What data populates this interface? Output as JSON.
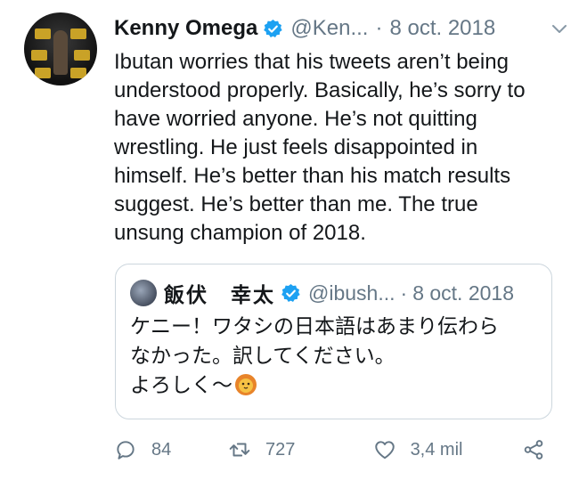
{
  "tweet": {
    "author_name": "Kenny Omega",
    "author_handle": "@Ken...",
    "separator": "·",
    "date": "8 oct. 2018",
    "text": "Ibutan worries that his tweets aren’t being\nunderstood properly. Basically, he’s sorry to\nhave worried anyone. He’s not quitting\nwrestling. He just feels disappointed in\nhimself. He’s better than his match results\nsuggest. He’s better than me. The true\nunsung champion of 2018."
  },
  "quoted_tweet": {
    "author_name": "飯伏　幸太",
    "author_handle": "@ibush...",
    "separator": "·",
    "date": "8 oct. 2018",
    "text_lines": "ケニー！ワタシの日本語はあまり伝わら\nなかった。訳してください。\nよろしく〜",
    "emoji_icon": "lion-face-emoji"
  },
  "actions": {
    "reply_count": "84",
    "retweet_count": "727",
    "like_count": "3,4 mil"
  },
  "colors": {
    "accent_verified": "#1da1f2",
    "secondary_text": "#657786",
    "border": "#ccd6dd"
  }
}
